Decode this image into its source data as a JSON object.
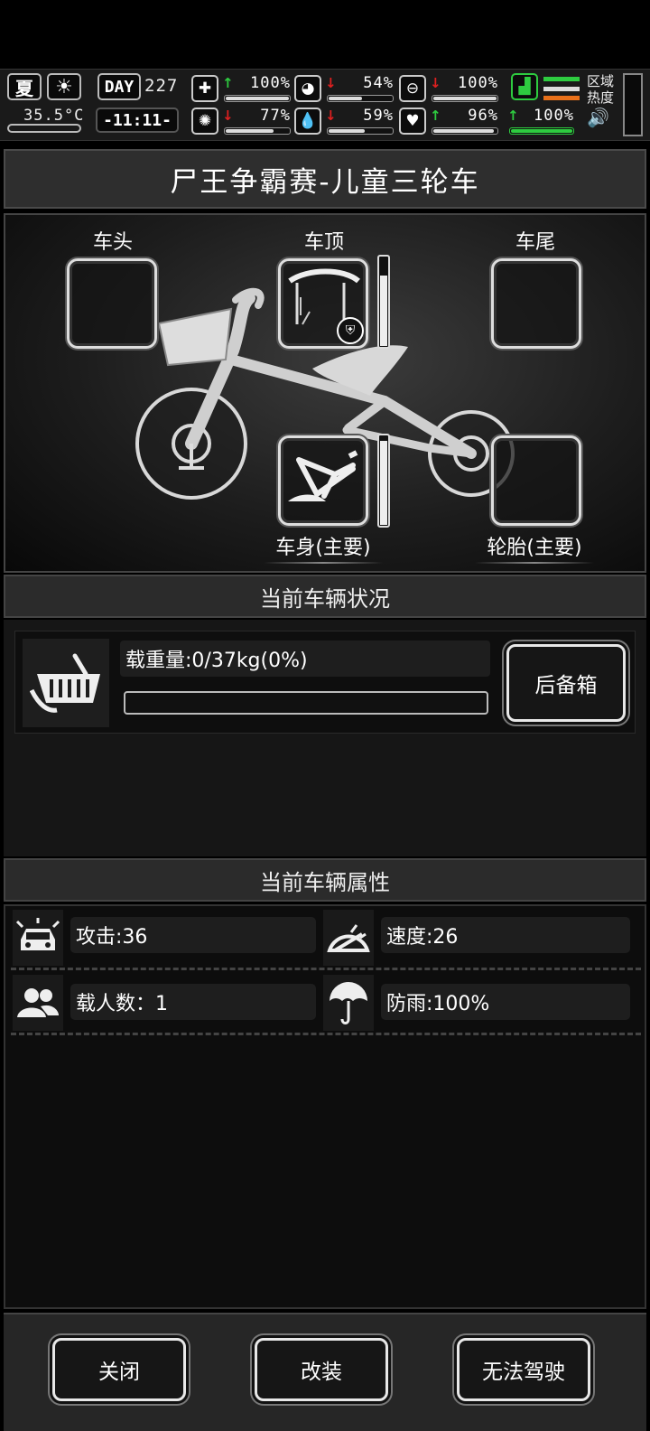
{
  "status_bar": {
    "season": "夏",
    "temperature": "35.5°C",
    "day_label": "DAY",
    "day_number": "227",
    "clock": "-11:11-",
    "region_heat_label_1": "区域",
    "region_heat_label_2": "热度",
    "stats": [
      {
        "name": "health",
        "icon": "medkit-icon",
        "trend": "up",
        "value": "100%",
        "level": 1.0
      },
      {
        "name": "hunger",
        "icon": "stomach-icon",
        "trend": "down",
        "value": "54%",
        "level": 0.54
      },
      {
        "name": "sanity",
        "icon": "capsule-icon",
        "trend": "down",
        "value": "100%",
        "level": 1.0
      },
      {
        "name": "mood",
        "icon": "brain-icon",
        "trend": "down",
        "value": "77%",
        "level": 0.77
      },
      {
        "name": "thirst",
        "icon": "water-drop-icon",
        "trend": "down",
        "value": "59%",
        "level": 0.59
      },
      {
        "name": "heart",
        "icon": "heart-icon",
        "trend": "up",
        "value": "96%",
        "level": 0.96
      },
      {
        "name": "stamina",
        "icon": "boot-icon",
        "trend": "up",
        "value": "100%",
        "level": 1.0
      }
    ]
  },
  "title": "尸王争霸赛-儿童三轮车",
  "slots": {
    "head": "车头",
    "roof": "车顶",
    "tail": "车尾",
    "body": "车身(主要)",
    "tire": "轮胎(主要)",
    "roof_durability": 0.8,
    "body_durability": 0.95
  },
  "status_section": {
    "header": "当前车辆状况",
    "load_label": "载重量:0/37kg(0%)",
    "load_level": 0.0,
    "trunk_button": "后备箱"
  },
  "attributes": {
    "header": "当前车辆属性",
    "attack": "攻击:36",
    "speed": "速度:26",
    "passengers": "载人数：1",
    "rain_protection": "防雨:100%"
  },
  "footer": {
    "close": "关闭",
    "modify": "改装",
    "drive": "无法驾驶"
  }
}
